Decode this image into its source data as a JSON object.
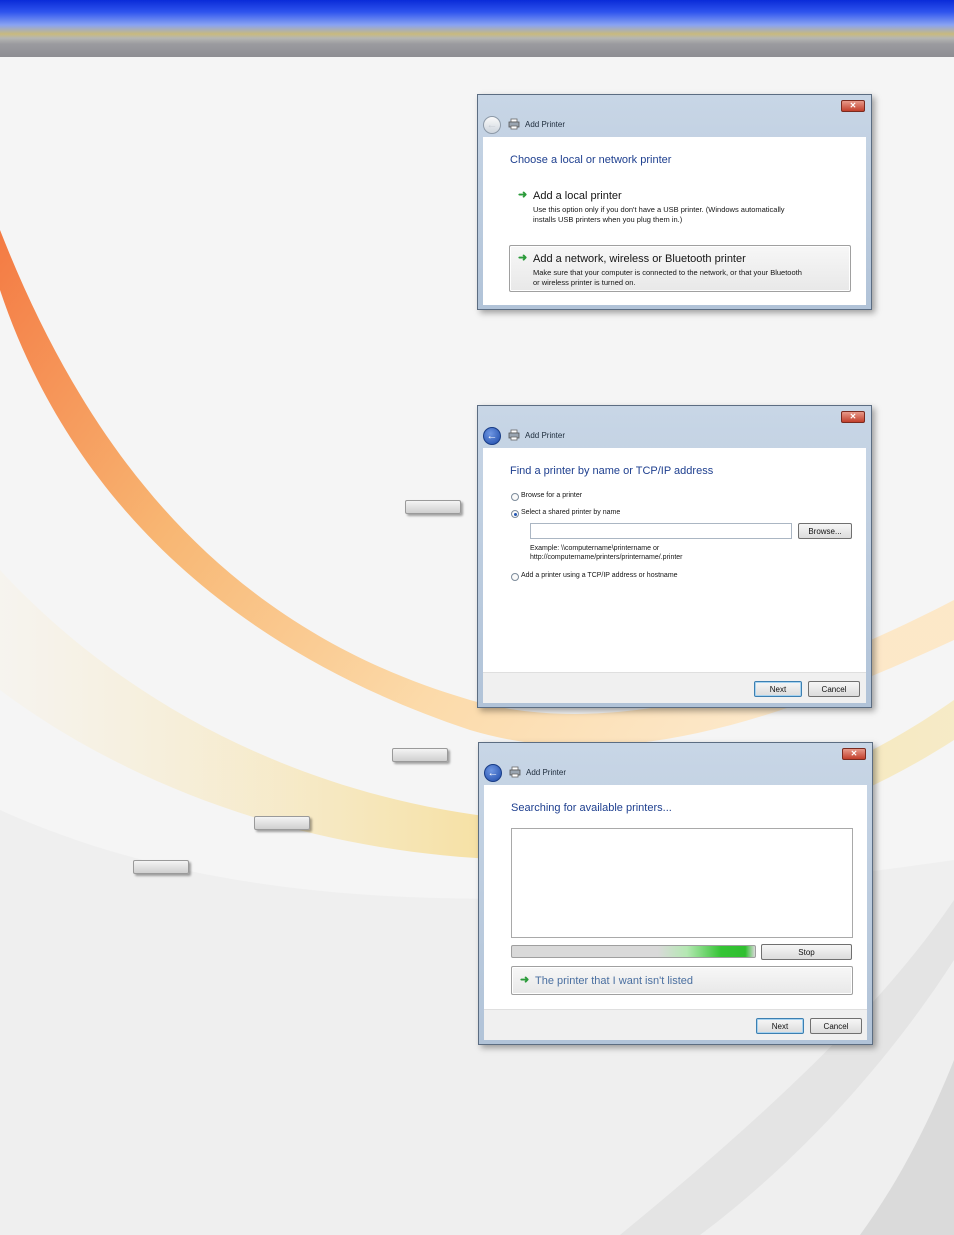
{
  "window1": {
    "title": "Add Printer",
    "heading": "Choose a local or network printer",
    "option1_title": "Add a local printer",
    "option1_desc_line1": "Use this option only if you don't have a USB printer. (Windows automatically",
    "option1_desc_line2": "installs USB printers when you plug them in.)",
    "option2_title": "Add a network, wireless or Bluetooth printer",
    "option2_desc_line1": "Make sure that your computer is connected to the network, or that your Bluetooth",
    "option2_desc_line2": "or wireless printer is turned on."
  },
  "window2": {
    "title": "Add Printer",
    "heading": "Find a printer by name or TCP/IP address",
    "radio_browse": "Browse for a printer",
    "radio_select_shared": "Select a shared printer by name",
    "printer_name_value": "",
    "browse_button": "Browse...",
    "example_line1": "Example: \\\\computername\\printername or",
    "example_line2": "http://computername/printers/printername/.printer",
    "radio_tcpip": "Add a printer using a TCP/IP address or hostname",
    "next_button": "Next",
    "cancel_button": "Cancel"
  },
  "window3": {
    "title": "Add Printer",
    "heading": "Searching for available printers...",
    "search_progress": 0.85,
    "stop_button": "Stop",
    "not_listed": "The printer that I want isn't listed",
    "next_button": "Next",
    "cancel_button": "Cancel"
  },
  "colors": {
    "topbar_blue": "#0a2bd8",
    "heading_blue": "#1e3f8f",
    "arrow_green": "#2b9b3a",
    "swoosh_orange": "#f6a25a"
  },
  "icons": {
    "close": "close-icon",
    "back": "back-arrow-icon",
    "printer": "printer-icon",
    "option_arrow": "green-arrow-icon"
  }
}
